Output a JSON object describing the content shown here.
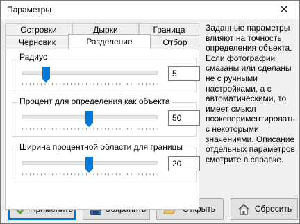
{
  "window": {
    "title": "Параметры"
  },
  "tabs": {
    "back_row": [
      "Островки",
      "Дырки",
      "Граница"
    ],
    "front_row": [
      "Черновик",
      "Разделение",
      "Отбор"
    ],
    "active": "Разделение"
  },
  "sliders": [
    {
      "label": "Радиус",
      "value": "5",
      "level_fraction": 0.2
    },
    {
      "label": "Процент для определения как объекта",
      "value": "50",
      "level_fraction": 0.5
    },
    {
      "label": "Ширина процентной области для границы",
      "value": "20",
      "level_fraction": 0.5
    }
  ],
  "help_text": "Заданные параметры влияют на точность определения объекта. Если фотографии смазаны или сделаны не с ручными настройками, а с автоматическими, то имеет смысл поэкспериментировать с некоторыми значениями. Описание отдельных параметров смотрите в справке.",
  "buttons": {
    "apply": "Применить",
    "save": "Сохранить",
    "open": "Открыть",
    "reset": "Сбросить"
  },
  "icons": {
    "apply": "checkmark-icon",
    "save": "floppy-disk-icon",
    "open": "open-folder-icon",
    "reset": "home-icon",
    "close": "close-icon"
  },
  "colors": {
    "accent": "#0078d7",
    "checkmark": "#5aa82a"
  }
}
